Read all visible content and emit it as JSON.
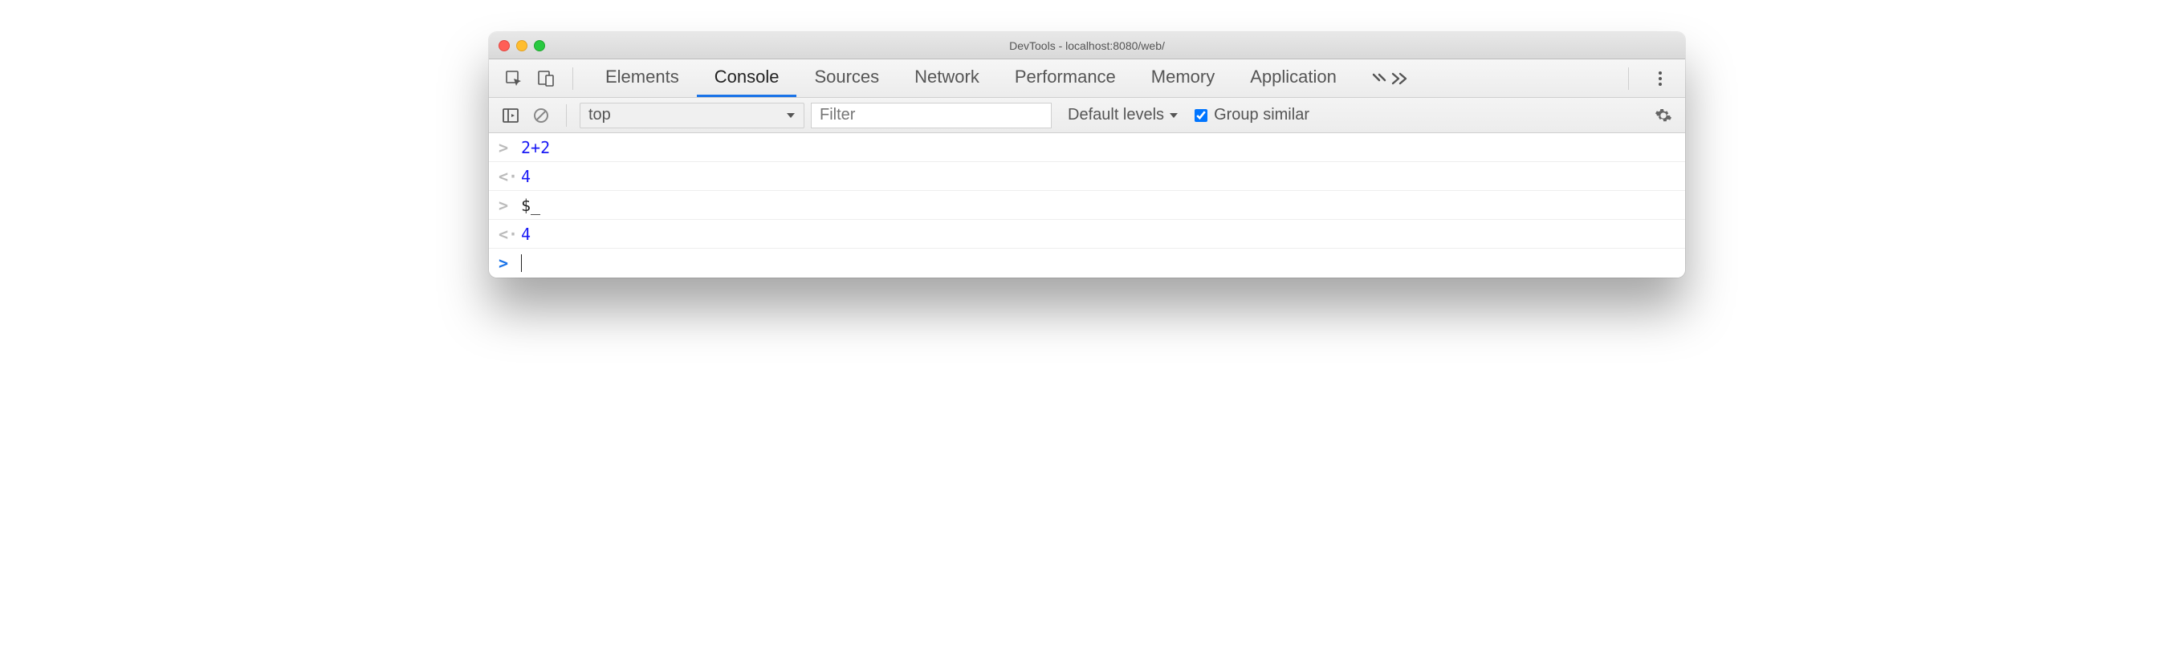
{
  "window": {
    "title": "DevTools - localhost:8080/web/"
  },
  "tabs": {
    "items": [
      "Elements",
      "Console",
      "Sources",
      "Network",
      "Performance",
      "Memory",
      "Application"
    ],
    "active": "Console"
  },
  "toolbar": {
    "context": "top",
    "filter_placeholder": "Filter",
    "levels_label": "Default levels",
    "group_similar_label": "Group similar",
    "group_similar_checked": true
  },
  "console": {
    "entries": [
      {
        "kind": "input",
        "text": "2+2"
      },
      {
        "kind": "output",
        "text": "4"
      },
      {
        "kind": "input",
        "text": "$_"
      },
      {
        "kind": "output",
        "text": "4"
      }
    ]
  }
}
